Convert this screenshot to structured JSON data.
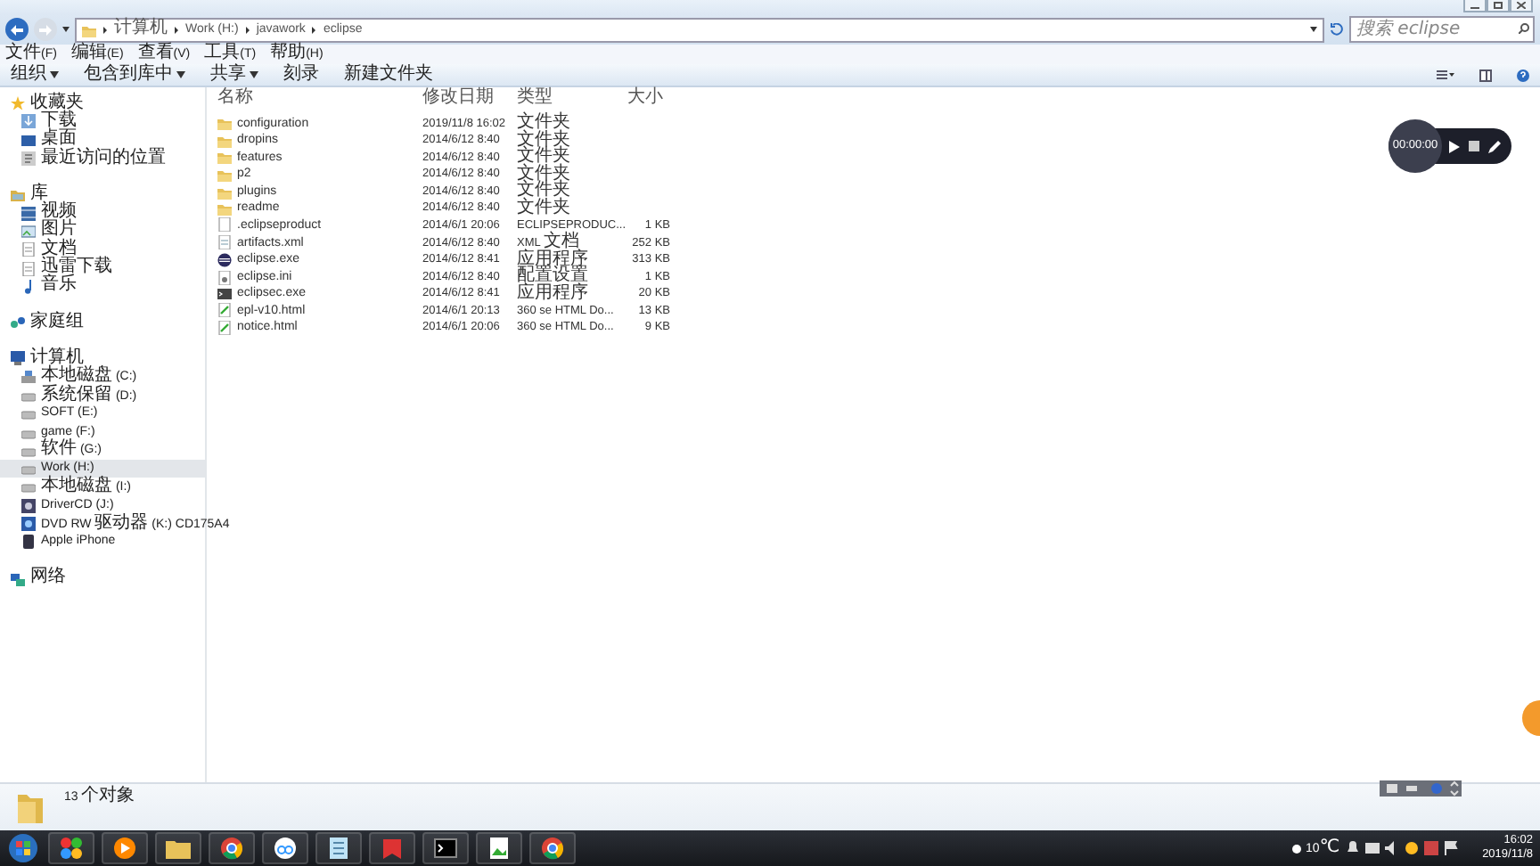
{
  "address_bar": {
    "path": [
      "计算机",
      "Work (H:)",
      "javawork",
      "eclipse"
    ]
  },
  "search": {
    "placeholder": "搜索 eclipse"
  },
  "menu": [
    "文件(F)",
    "编辑(E)",
    "查看(V)",
    "工具(T)",
    "帮助(H)"
  ],
  "toolbar": [
    {
      "label": "组织",
      "dropdown": true
    },
    {
      "label": "包含到库中",
      "dropdown": true
    },
    {
      "label": "共享",
      "dropdown": true
    },
    {
      "label": "刻录",
      "dropdown": false
    },
    {
      "label": "新建文件夹",
      "dropdown": false
    }
  ],
  "sidebar": [
    {
      "label": "收藏夹",
      "kind": "star",
      "selected": false,
      "children": [
        {
          "label": "下载",
          "kind": "download",
          "selected": false
        },
        {
          "label": "桌面",
          "kind": "desktop",
          "selected": false
        },
        {
          "label": "最近访问的位置",
          "kind": "recent",
          "selected": false
        }
      ]
    },
    {
      "label": "库",
      "kind": "library",
      "selected": false,
      "children": [
        {
          "label": "视频",
          "kind": "video",
          "selected": false
        },
        {
          "label": "图片",
          "kind": "picture",
          "selected": false
        },
        {
          "label": "文档",
          "kind": "document",
          "selected": false
        },
        {
          "label": "迅雷下载",
          "kind": "document",
          "selected": false
        },
        {
          "label": "音乐",
          "kind": "music",
          "selected": false
        }
      ]
    },
    {
      "label": "家庭组",
      "kind": "homegroup",
      "selected": false
    },
    {
      "label": "计算机",
      "kind": "computer",
      "selected": false,
      "children": [
        {
          "label": "本地磁盘 (C:)",
          "kind": "system",
          "selected": false
        },
        {
          "label": "系统保留 (D:)",
          "kind": "drive",
          "selected": false
        },
        {
          "label": "SOFT (E:)",
          "kind": "drive",
          "selected": false
        },
        {
          "label": "game (F:)",
          "kind": "drive",
          "selected": false
        },
        {
          "label": "软件 (G:)",
          "kind": "drive",
          "selected": false
        },
        {
          "label": "Work (H:)",
          "kind": "drive",
          "selected": true
        },
        {
          "label": "本地磁盘 (I:)",
          "kind": "drive",
          "selected": false
        },
        {
          "label": "DriverCD (J:)",
          "kind": "disc",
          "selected": false
        },
        {
          "label": "DVD RW 驱动器 (K:) CD175A4",
          "kind": "dvd",
          "selected": false
        },
        {
          "label": "Apple iPhone",
          "kind": "phone",
          "selected": false
        }
      ]
    },
    {
      "label": "网络",
      "kind": "network",
      "selected": false
    }
  ],
  "file_list": {
    "columns": [
      "名称",
      "修改日期",
      "类型",
      "大小"
    ],
    "rows": [
      {
        "name": "configuration",
        "modified": "2019/11/8 16:02",
        "type": "文件夹",
        "size": "",
        "kind": "folder"
      },
      {
        "name": "dropins",
        "modified": "2014/6/12 8:40",
        "type": "文件夹",
        "size": "",
        "kind": "folder"
      },
      {
        "name": "features",
        "modified": "2014/6/12 8:40",
        "type": "文件夹",
        "size": "",
        "kind": "folder"
      },
      {
        "name": "p2",
        "modified": "2014/6/12 8:40",
        "type": "文件夹",
        "size": "",
        "kind": "folder"
      },
      {
        "name": "plugins",
        "modified": "2014/6/12 8:40",
        "type": "文件夹",
        "size": "",
        "kind": "folder"
      },
      {
        "name": "readme",
        "modified": "2014/6/12 8:40",
        "type": "文件夹",
        "size": "",
        "kind": "folder"
      },
      {
        "name": ".eclipseproduct",
        "modified": "2014/6/1 20:06",
        "type": "ECLIPSEPRODUC...",
        "size": "1 KB",
        "kind": "file"
      },
      {
        "name": "artifacts.xml",
        "modified": "2014/6/12 8:40",
        "type": "XML 文档",
        "size": "252 KB",
        "kind": "xml"
      },
      {
        "name": "eclipse.exe",
        "modified": "2014/6/12 8:41",
        "type": "应用程序",
        "size": "313 KB",
        "kind": "app"
      },
      {
        "name": "eclipse.ini",
        "modified": "2014/6/12 8:40",
        "type": "配置设置",
        "size": "1 KB",
        "kind": "ini"
      },
      {
        "name": "eclipsec.exe",
        "modified": "2014/6/12 8:41",
        "type": "应用程序",
        "size": "20 KB",
        "kind": "console"
      },
      {
        "name": "epl-v10.html",
        "modified": "2014/6/1 20:13",
        "type": "360 se HTML Do...",
        "size": "13 KB",
        "kind": "web"
      },
      {
        "name": "notice.html",
        "modified": "2014/6/1 20:06",
        "type": "360 se HTML Do...",
        "size": "9 KB",
        "kind": "web"
      }
    ]
  },
  "details_pane": {
    "count": "13 个对象"
  },
  "recorder": {
    "time": "00:00:00"
  },
  "taskbar": {
    "temperature": "10℃",
    "clock_time": "16:02",
    "clock_date": "2019/11/8"
  }
}
